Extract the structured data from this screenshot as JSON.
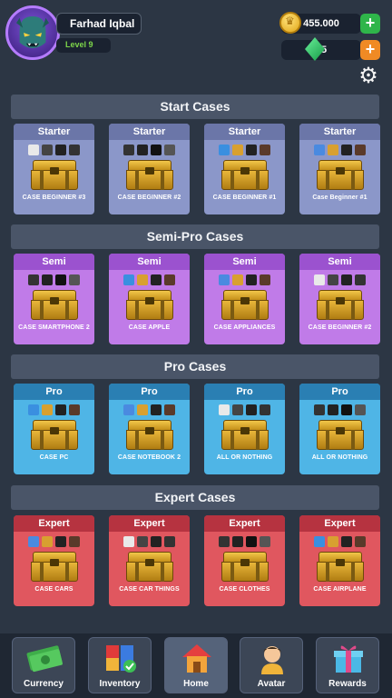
{
  "player": {
    "name": "Farhad Iqbal",
    "level": "Level 9"
  },
  "resources": {
    "coins": "455.000",
    "gems": "25"
  },
  "sections": [
    {
      "title": "Start Cases",
      "cards": [
        {
          "tier": "Starter",
          "name": "CASE BEGINNER #3"
        },
        {
          "tier": "Starter",
          "name": "CASE BEGINNER #2"
        },
        {
          "tier": "Starter",
          "name": "CASE BEGINNER #1"
        },
        {
          "tier": "Starter",
          "name": "Case Beginner #1"
        }
      ]
    },
    {
      "title": "Semi-Pro Cases",
      "cards": [
        {
          "tier": "Semi",
          "name": "CASE SMARTPHONE 2"
        },
        {
          "tier": "Semi",
          "name": "CASE APPLE"
        },
        {
          "tier": "Semi",
          "name": "CASE APPLIANCES"
        },
        {
          "tier": "Semi",
          "name": "CASE BEGINNER #2"
        }
      ]
    },
    {
      "title": "Pro Cases",
      "cards": [
        {
          "tier": "Pro",
          "name": "CASE PC"
        },
        {
          "tier": "Pro",
          "name": "CASE NOTEBOOK 2"
        },
        {
          "tier": "Pro",
          "name": "ALL OR NOTHING"
        },
        {
          "tier": "Pro",
          "name": "ALL OR NOTHING"
        }
      ]
    },
    {
      "title": "Expert Cases",
      "cards": [
        {
          "tier": "Expert",
          "name": "CASE CARS"
        },
        {
          "tier": "Expert",
          "name": "CASE CAR THINGS"
        },
        {
          "tier": "Expert",
          "name": "CASE CLOTHES"
        },
        {
          "tier": "Expert",
          "name": "CASE AIRPLANE"
        }
      ]
    }
  ],
  "nav": [
    {
      "label": "Currency",
      "icon": "money-icon"
    },
    {
      "label": "Inventory",
      "icon": "inventory-icon"
    },
    {
      "label": "Home",
      "icon": "home-icon"
    },
    {
      "label": "Avatar",
      "icon": "avatar-icon"
    },
    {
      "label": "Rewards",
      "icon": "gift-icon"
    }
  ],
  "colors": {
    "starter": "#8b97c9",
    "semi": "#c07be8",
    "pro": "#4fb5e6",
    "expert": "#e0575f",
    "background": "#2c3644",
    "level_text": "#7dd64a"
  }
}
